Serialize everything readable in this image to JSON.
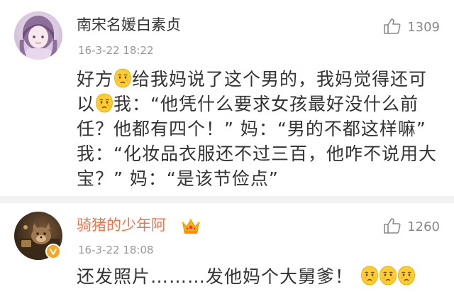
{
  "comments": [
    {
      "username": "南宋名媛白素贞",
      "timestamp": "16-3-22 18:22",
      "likes": "1309",
      "text": {
        "p1": "好方",
        "p2": "给我妈说了这个男的，我妈觉得还可以",
        "p3": "我：“他凭什么要求女孩最好没什么前任？他都有四个！”  妈：“男的不都这样嘛”  我：“化妆品衣服还不过三百，他咋不说用大宝？”  妈：“是该节俭点”"
      },
      "emoji_icon": "smirk-emoji-icon"
    },
    {
      "username": "骑猪的少年阿",
      "username_color": "#eb7350",
      "timestamp": "16-3-22 18:08",
      "likes": "1260",
      "text": {
        "p1": "还发照片………发他妈个大舅爹！"
      },
      "emoji_icon": "smirk-emoji-icon",
      "badges": [
        "vip-crown-icon",
        "verified-badge-icon"
      ]
    }
  ],
  "colors": {
    "accent": "#eb7350",
    "muted": "#999999",
    "divider": "#f2f2f2",
    "emoji": "#ffcc33"
  }
}
